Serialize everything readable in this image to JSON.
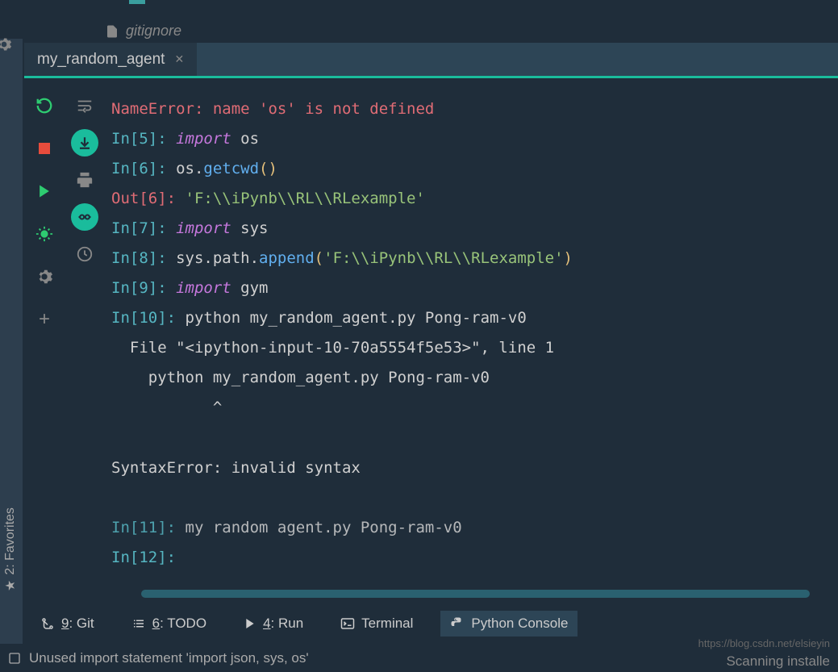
{
  "file_tree": {
    "gitignore": "gitignore"
  },
  "tab": {
    "label": "my_random_agent",
    "close": "✕"
  },
  "sidebar": {
    "favorites": "2: Favorites"
  },
  "console": {
    "error_line": "NameError: name 'os' is not defined",
    "lines": {
      "in5": {
        "prompt": "In[5]:",
        "kw": "import",
        "rest": " os"
      },
      "in6": {
        "prompt": "In[6]:",
        "code": " os.",
        "fn": "getcwd",
        "par": "()"
      },
      "out6": {
        "prompt": "Out[6]:",
        "str": " 'F:\\\\iPynb\\\\RL\\\\RLexample'"
      },
      "in7": {
        "prompt": "In[7]:",
        "kw": "import",
        "rest": " sys"
      },
      "in8": {
        "prompt": "In[8]:",
        "pre": " sys.path.",
        "fn": "append",
        "open": "(",
        "str": "'F:\\\\iPynb\\\\RL\\\\RLexample'",
        "close": ")"
      },
      "in9": {
        "prompt": "In[9]:",
        "kw": "import",
        "rest": " gym"
      },
      "in10": {
        "prompt": "In[10]:",
        "rest": " python my_random_agent.py Pong-ram-v0"
      },
      "file_line": "  File \"<ipython-input-10-70a5554f5e53>\", line 1",
      "echo_line": "    python my_random_agent.py Pong-ram-v0",
      "caret_line": "           ^",
      "syntax_err": "SyntaxError: invalid syntax",
      "in11": {
        "prompt": "In[11]:",
        "rest": " my random agent.py Pong-ram-v0"
      },
      "in12": {
        "prompt": "In[12]:",
        "rest": " "
      }
    }
  },
  "tools": {
    "git": {
      "num": "9",
      "label": ": Git"
    },
    "todo": {
      "num": "6",
      "label": ": TODO"
    },
    "run": {
      "num": "4",
      "label": ": Run"
    },
    "terminal": "Terminal",
    "pyconsole": "Python Console"
  },
  "status": {
    "warning": "Unused import statement 'import json, sys, os'",
    "scanning": "Scanning installe"
  },
  "watermark": "https://blog.csdn.net/elsieyin"
}
